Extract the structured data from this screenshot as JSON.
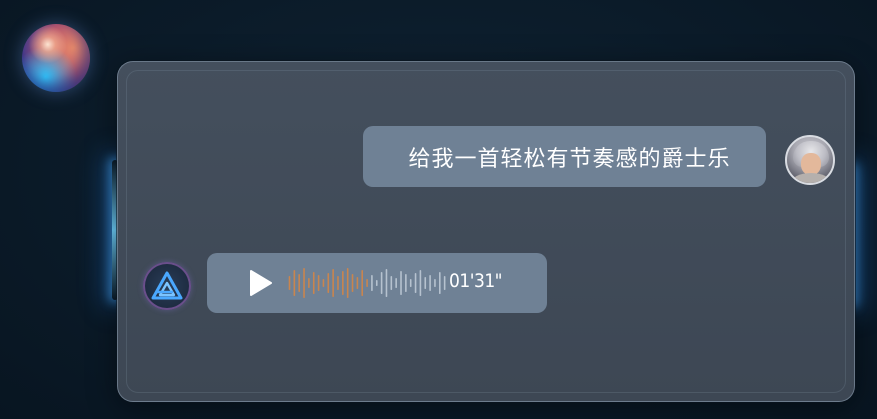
{
  "colors": {
    "bubble": "#6f8195",
    "panel": "#414b58",
    "played_wave": "#c9854e",
    "unplayed_wave": "#b6c2cf",
    "glow": "#5ab8ff"
  },
  "icons": {
    "assistant_orb": "assistant-orb-icon",
    "user_avatar": "user-avatar-icon",
    "ai_avatar": "ai-logo-icon",
    "play": "play-icon"
  },
  "conversation": {
    "user_message": "给我一首轻松有节奏感的爵士乐",
    "voice_reply": {
      "duration": "01'31\"",
      "progress": 0.5
    }
  }
}
